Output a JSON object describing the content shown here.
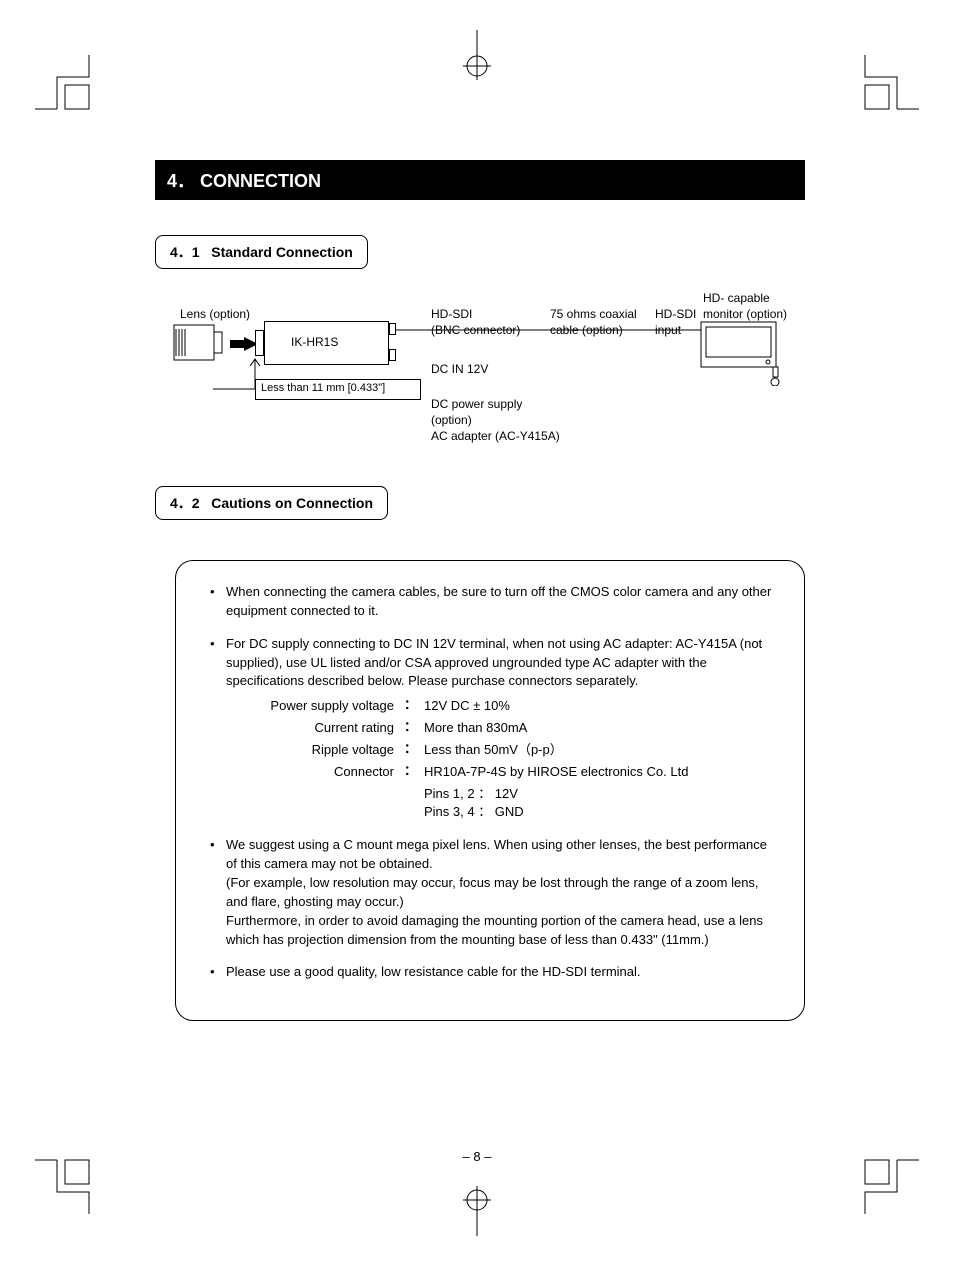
{
  "section": {
    "number": "4．",
    "title": "CONNECTION"
  },
  "subsection1": {
    "number": "4．1",
    "title": "Standard Connection"
  },
  "subsection2": {
    "number": "4．2",
    "title": "Cautions on Connection"
  },
  "diagram": {
    "lens_label": "Lens (option)",
    "camera_label": "IK-HR1S",
    "clearance": "Less than 11 mm [0.433\"]",
    "hdsdi_label": "HD-SDI",
    "bnc_label": "(BNC connector)",
    "cable_top": "75 ohms coaxial",
    "cable_bot": "cable (option)",
    "dc_in": "DC IN 12V",
    "dc_supply1": "DC power supply",
    "dc_supply2": "(option)",
    "dc_supply3": "AC adapter (AC-Y415A)",
    "monitor_input_top": "HD-SDI",
    "monitor_input_bot": "input",
    "monitor_label_top": "HD- capable",
    "monitor_label_bot": "monitor (option)"
  },
  "cautions": {
    "item1": "When connecting the camera cables, be sure to turn off the CMOS color camera and any other equipment connected to it.",
    "item2": "For DC supply connecting to DC IN 12V terminal, when not using AC adapter: AC-Y415A (not supplied), use UL listed and/or CSA approved ungrounded type AC adapter with the specifications described below. Please purchase connectors separately.",
    "specs": {
      "row1_label": "Power supply voltage",
      "row1_value": "12V DC ± 10%",
      "row2_label": "Current rating",
      "row2_value": "More than 830mA",
      "row3_label": "Ripple voltage",
      "row3_value": "Less than 50mV（p-p）",
      "row4_label": "Connector",
      "row4_value": "HR10A-7P-4S by HIROSE electronics Co. Ltd",
      "row4_pins1": "Pins 1, 2 ： 12V",
      "row4_pins2": "Pins 3, 4 ： GND"
    },
    "item3": "We suggest using a C mount mega pixel lens. When using other lenses, the best performance of this camera may not be obtained.\n(For example, low resolution may occur, focus may be lost through the range of a zoom lens, and flare, ghosting may occur.)\nFurthermore, in order to avoid damaging the mounting portion of the camera head, use a lens which has projection dimension from the mounting base of less than 0.433\" (11mm.)",
    "item4": "Please use a good quality, low resistance cable for the HD-SDI terminal."
  },
  "page_number": "8"
}
